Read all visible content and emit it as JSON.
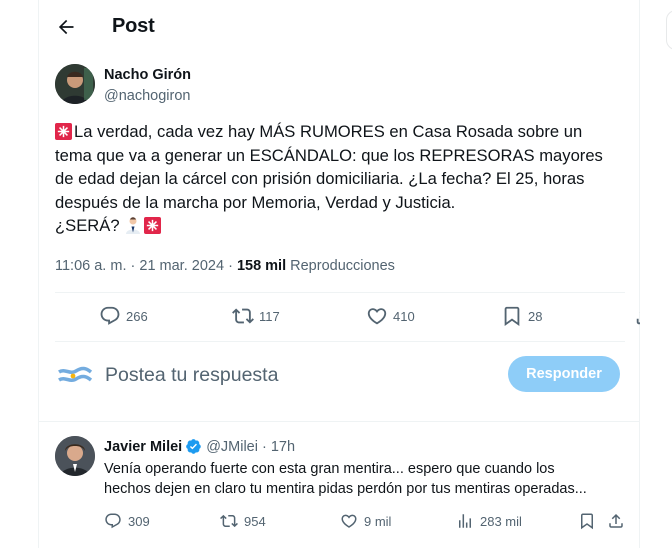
{
  "header": {
    "title": "Post"
  },
  "post": {
    "author_name": "Nacho Girón",
    "author_handle": "@nachogiron",
    "text_lines": [
      "La verdad, cada vez hay MÁS RUMORES en Casa Rosada sobre un",
      "tema que va a generar un ESCÁNDALO: que los REPRESORAS mayores",
      "de edad dejan la cárcel con prisión domiciliaria. ¿La fecha? El 25, horas",
      "después de la marcha por Memoria, Verdad y Justicia.",
      "¿SERÁ?"
    ],
    "time": "11:06 a. m.",
    "date": "21 mar. 2024",
    "views_count": "158 mil",
    "views_label": "Reproducciones",
    "meta_sep": "·",
    "counts": {
      "replies": "266",
      "reposts": "117",
      "likes": "410",
      "bookmarks": "28"
    }
  },
  "composer": {
    "placeholder": "Postea tu respuesta",
    "reply_button": "Responder"
  },
  "reply": {
    "author_name": "Javier Milei",
    "author_handle": "@JMilei",
    "dot": "·",
    "time": "17h",
    "line1": "Venía operando fuerte con esta gran mentira... espero que cuando los",
    "line2": "hechos dejen en claro tu mentira pidas perdón por tus mentiras operadas...",
    "counts": {
      "replies": "309",
      "reposts": "954",
      "likes": "9 mil",
      "views": "283 mil"
    }
  },
  "colors": {
    "accent": "#1d9bf0",
    "reply_button_disabled": "#8ecdf8",
    "muted": "#536471",
    "siren": "#e1264a"
  },
  "icons": [
    "back-arrow-icon",
    "more-icon",
    "siren-icon",
    "person-icon",
    "reply-icon",
    "repost-icon",
    "like-icon",
    "bookmark-icon",
    "share-icon",
    "verified-badge-icon",
    "views-icon"
  ]
}
